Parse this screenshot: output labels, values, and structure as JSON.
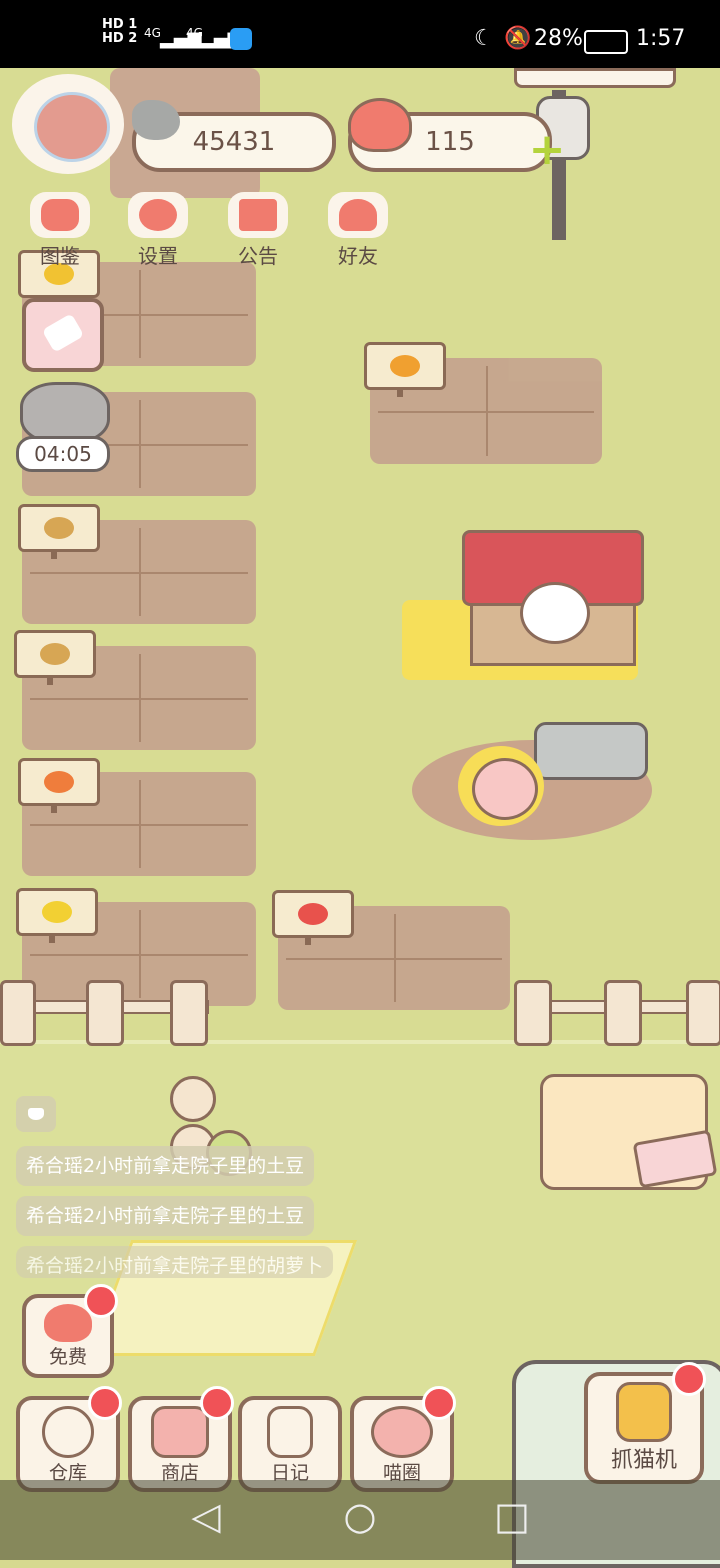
{
  "status": {
    "signal_text_1": "HD 1",
    "signal_text_2": "HD 2",
    "net1": "4G",
    "net2": "4G",
    "battery": "28%",
    "time": "1:57"
  },
  "resources": {
    "fish": "45431",
    "hearts": "115"
  },
  "top_menu": [
    {
      "label": "图鉴",
      "icon": "cat-book-icon"
    },
    {
      "label": "设置",
      "icon": "gear-icon"
    },
    {
      "label": "公告",
      "icon": "gift-icon"
    },
    {
      "label": "好友",
      "icon": "friends-icon"
    }
  ],
  "timer": "04:05",
  "feed": [
    "希合瑶2小时前拿走院子里的土豆",
    "希合瑶2小时前拿走院子里的土豆",
    "希合瑶2小时前拿走院子里的胡萝卜"
  ],
  "buttons": {
    "free": "免费",
    "warehouse": "仓库",
    "shop": "商店",
    "diary": "日记",
    "circle": "喵圈",
    "claw": "抓猫机"
  },
  "colors": {
    "accent_red": "#f05257",
    "grass": "#d8dc93",
    "soil": "#c6a58e",
    "outline": "#8b6b5a"
  }
}
